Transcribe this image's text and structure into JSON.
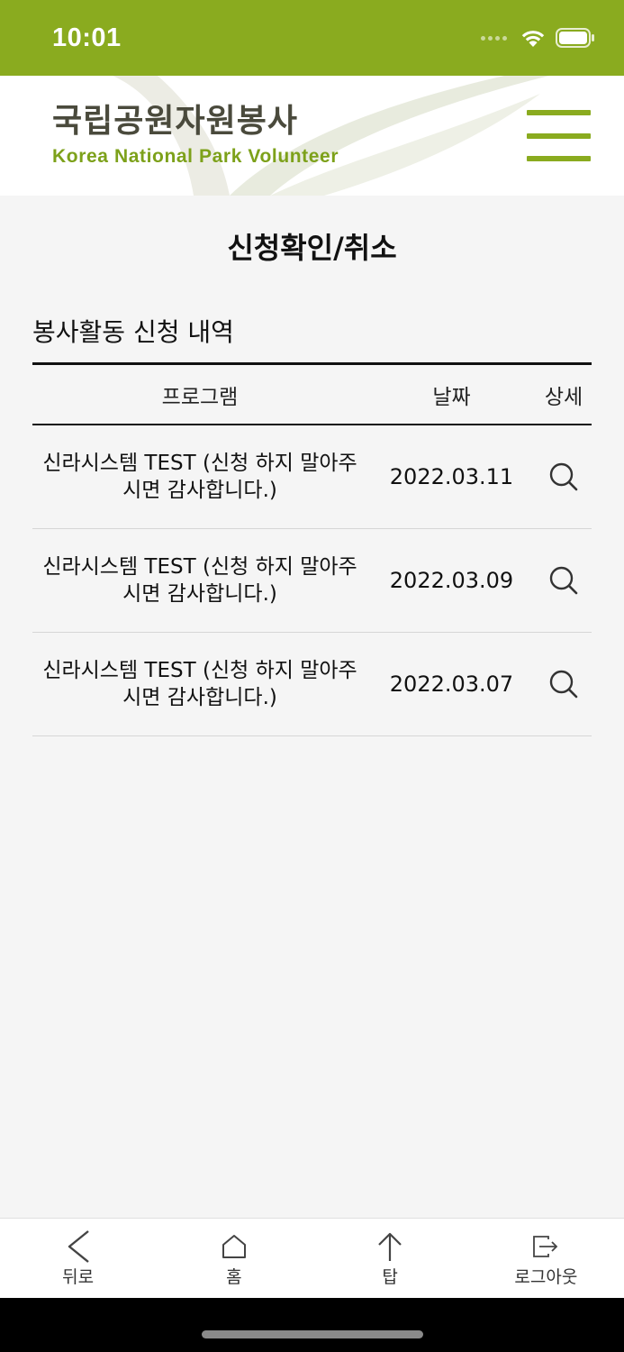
{
  "status_bar": {
    "time": "10:01"
  },
  "header": {
    "logo_title": "국립공원자원봉사",
    "logo_subtitle": "Korea National Park Volunteer"
  },
  "page": {
    "title": "신청확인/취소",
    "section_title": "봉사활동 신청 내역"
  },
  "table": {
    "headers": {
      "program": "프로그램",
      "date": "날짜",
      "detail": "상세"
    },
    "rows": [
      {
        "program": "신라시스템 TEST (신청 하지 말아주시면 감사합니다.)",
        "date": "2022.03.11"
      },
      {
        "program": "신라시스템 TEST (신청 하지 말아주시면 감사합니다.)",
        "date": "2022.03.09"
      },
      {
        "program": "신라시스템 TEST (신청 하지 말아주시면 감사합니다.)",
        "date": "2022.03.07"
      }
    ]
  },
  "bottom_nav": {
    "back": "뒤로",
    "home": "홈",
    "top": "탑",
    "logout": "로그아웃"
  },
  "colors": {
    "brand_green": "#8aab1f",
    "logo_green": "#7da11a"
  },
  "icons": [
    "wifi-icon",
    "battery-icon",
    "menu-icon",
    "search-icon",
    "back-arrow-icon",
    "home-icon",
    "up-arrow-icon",
    "logout-icon"
  ]
}
